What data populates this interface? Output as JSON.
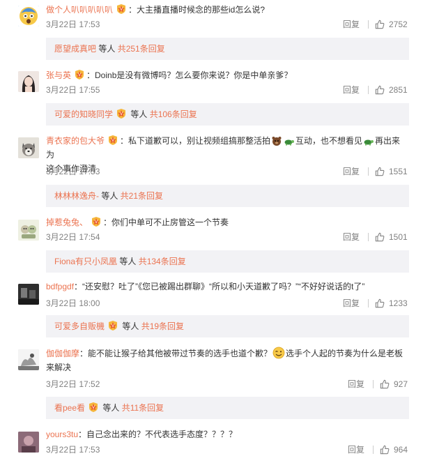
{
  "comments": [
    {
      "username": "做个人叭叭叭叭叭",
      "text": "：大主播直播时候念的那些id怎么说?",
      "time": "3月22日 17:53",
      "reply_label": "回复",
      "likes": "2752",
      "sub": {
        "name": "愿望成真吧",
        "mid": " 等人 ",
        "count": "共251条回复"
      }
    },
    {
      "username": "张与英",
      "text": "：Doinb是没有微博吗？怎么要你来说？你是中单亲爹？",
      "time": "3月22日 17:55",
      "reply_label": "回复",
      "likes": "2851",
      "sub": {
        "name": "可爱的知晓同学",
        "mid": " 等人 ",
        "count": "共106条回复"
      }
    },
    {
      "username": "青衣家的包大爷",
      "text_a": "：私下道歉可以，别让视频组搞那整活拍",
      "text_b": "互动，也不想看见",
      "text_c": "再出来为",
      "text_d": "这个事作澄清",
      "time": "3月22日 17:53",
      "reply_label": "回复",
      "likes": "1551",
      "sub": {
        "name": "林林林逸舟-",
        "mid": " 等人 ",
        "count": "共21条回复"
      }
    },
    {
      "username": "掉惹兔兔、",
      "text": "：你们中单可不止房管这一个节奏",
      "time": "3月22日 17:54",
      "reply_label": "回复",
      "likes": "1501",
      "sub": {
        "name": "Fiona有只小凤凰",
        "mid": " 等人 ",
        "count": "共134条回复"
      }
    },
    {
      "username": "bdfpgdf",
      "text": "：“还安慰？吐了”《您已被踢出群聊》“所以和小天道歉了吗？”“不好好说话的t了”",
      "time": "3月22日 18:00",
      "reply_label": "回复",
      "likes": "1233",
      "sub": {
        "name": "可爱多自贩機",
        "mid": " 等人 ",
        "count": "共19条回复"
      }
    },
    {
      "username": "伽伽伽摩",
      "text_a": "：能不能让猴子给其他被带过节奏的选手也道个歉？",
      "text_b": "选手个人起的节奏为什么是老板",
      "text_c": "来解决",
      "time": "3月22日 17:52",
      "reply_label": "回复",
      "likes": "927",
      "sub": {
        "name": "看pee看",
        "mid": " 等人 ",
        "count": "共11条回复"
      }
    },
    {
      "username": "yours3tu",
      "text": "：自己念出来的？不代表选手态度？？？？",
      "time": "3月22日 17:53",
      "reply_label": "回复",
      "likes": "964"
    }
  ]
}
